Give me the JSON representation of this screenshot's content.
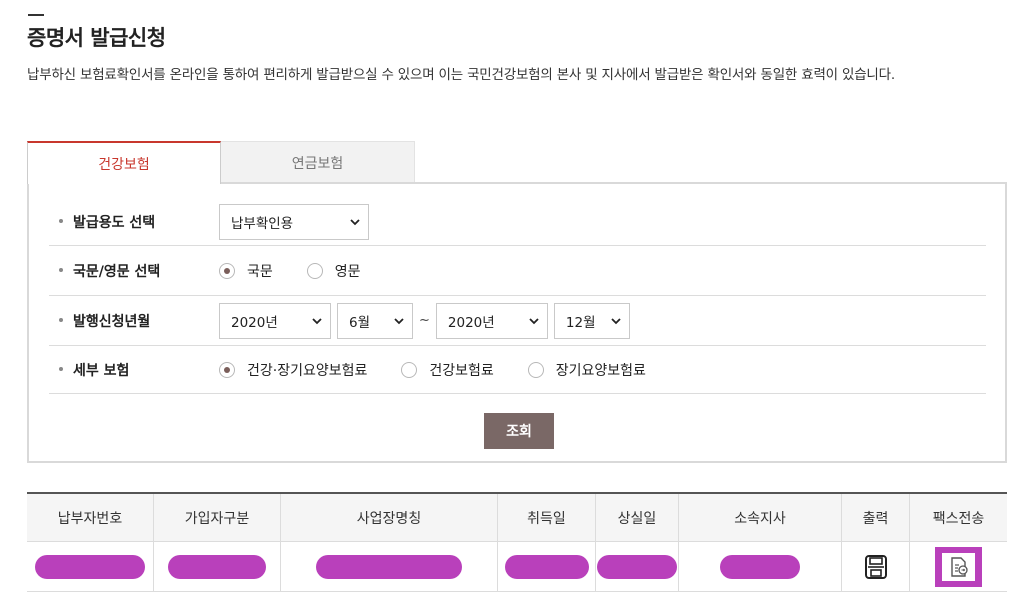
{
  "page": {
    "title": "증명서 발급신청",
    "description": "납부하신 보험료확인서를 온라인을 통하여 편리하게 발급받으실 수 있으며 이는 국민건강보험의 본사 및 지사에서 발급받은 확인서와 동일한 효력이 있습니다."
  },
  "tabs": [
    {
      "label": "건강보험",
      "active": true
    },
    {
      "label": "연금보험",
      "active": false
    }
  ],
  "form": {
    "purpose": {
      "label": "발급용도 선택",
      "value": "납부확인용"
    },
    "language": {
      "label": "국문/영문 선택",
      "options": [
        "국문",
        "영문"
      ],
      "selected": "국문"
    },
    "period": {
      "label": "발행신청년월",
      "from_year": "2020년",
      "from_month": "6월",
      "separator": "~",
      "to_year": "2020년",
      "to_month": "12월"
    },
    "insurance": {
      "label": "세부 보험",
      "options": [
        "건강·장기요양보험료",
        "건강보험료",
        "장기요양보험료"
      ],
      "selected": "건강·장기요양보험료"
    },
    "search_label": "조회"
  },
  "table": {
    "headers": [
      "납부자번호",
      "가입자구분",
      "사업장명칭",
      "취득일",
      "상실일",
      "소속지사",
      "출력",
      "팩스전송"
    ],
    "redaction_color": "#b940bb"
  },
  "colors": {
    "accent": "#c8372d",
    "button": "#7a6866",
    "radio_on": "#7a5e5a"
  },
  "icons": {
    "print": "printer-icon",
    "fax": "fax-document-icon",
    "select": "chevron-down-icon"
  }
}
